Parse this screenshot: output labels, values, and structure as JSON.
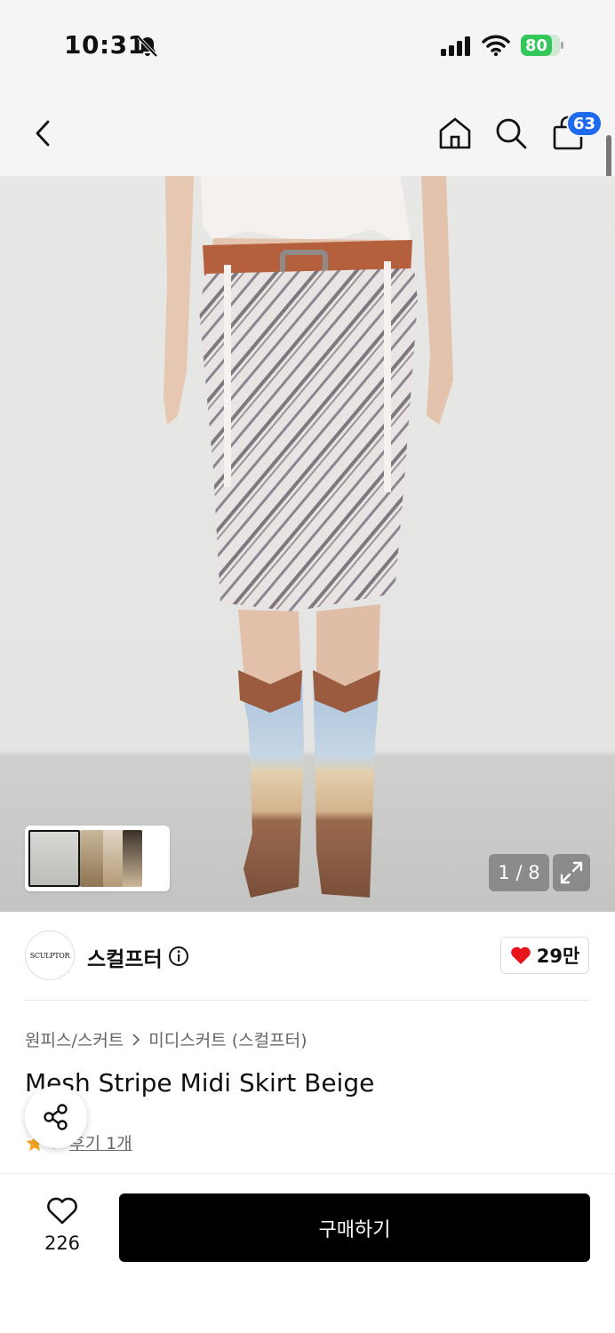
{
  "status_bar": {
    "time": "10:31",
    "battery": "80",
    "battery_level": 0.8
  },
  "header": {
    "cart_count": "63",
    "icons": [
      "back-icon",
      "home-icon",
      "search-icon",
      "shopping-bag-icon"
    ]
  },
  "gallery": {
    "counter": "1 / 8"
  },
  "brand": {
    "logo_text": "SCULPTOR",
    "name": "스컬프터",
    "likes": "29만"
  },
  "product": {
    "breadcrumb": [
      "원피스/스커트",
      "미디스커트 (스컬프터)"
    ],
    "title": "Mesh Stripe Midi Skirt Beige",
    "rating": "5",
    "review_text": "후기 1개"
  },
  "bottom": {
    "wish_count": "226",
    "buy_label": "구매하기"
  },
  "colors": {
    "badge": "#1e6bf0",
    "heart": "#e8141c",
    "star": "#f5a623",
    "buy_button": "#000000"
  }
}
